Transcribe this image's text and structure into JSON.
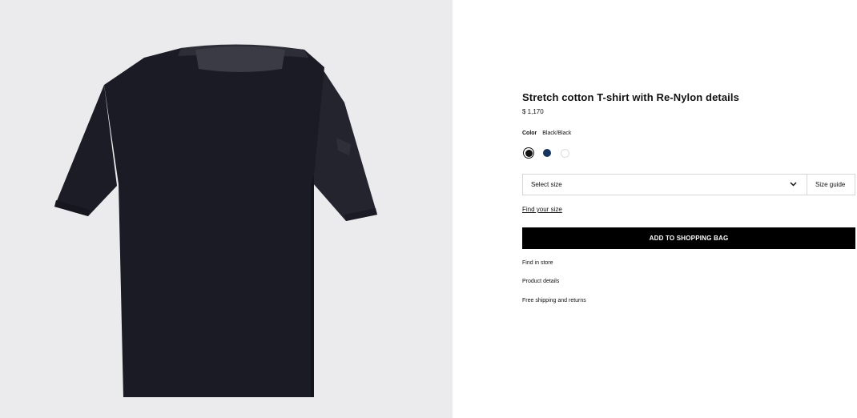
{
  "product": {
    "title": "Stretch cotton T-shirt with Re-Nylon details",
    "price": "$ 1,170",
    "image_label": "black-tshirt-image"
  },
  "color": {
    "label": "Color",
    "selected": "Black/Black",
    "swatches": [
      {
        "name": "black",
        "hex": "#111111",
        "selected": true
      },
      {
        "name": "navy",
        "hex": "#15335e",
        "selected": false
      },
      {
        "name": "white",
        "hex": "#ffffff",
        "selected": false
      }
    ]
  },
  "size": {
    "select_label": "Select size",
    "size_guide": "Size guide",
    "find_size": "Find your size"
  },
  "actions": {
    "add_to_bag": "ADD TO SHOPPING BAG"
  },
  "links": {
    "find_in_store": "Find in store",
    "product_details": "Product details",
    "shipping": "Free shipping and returns"
  },
  "colors": {
    "image_bg": "#ebebed",
    "garment": "#1a1b24",
    "button_bg": "#000000"
  }
}
